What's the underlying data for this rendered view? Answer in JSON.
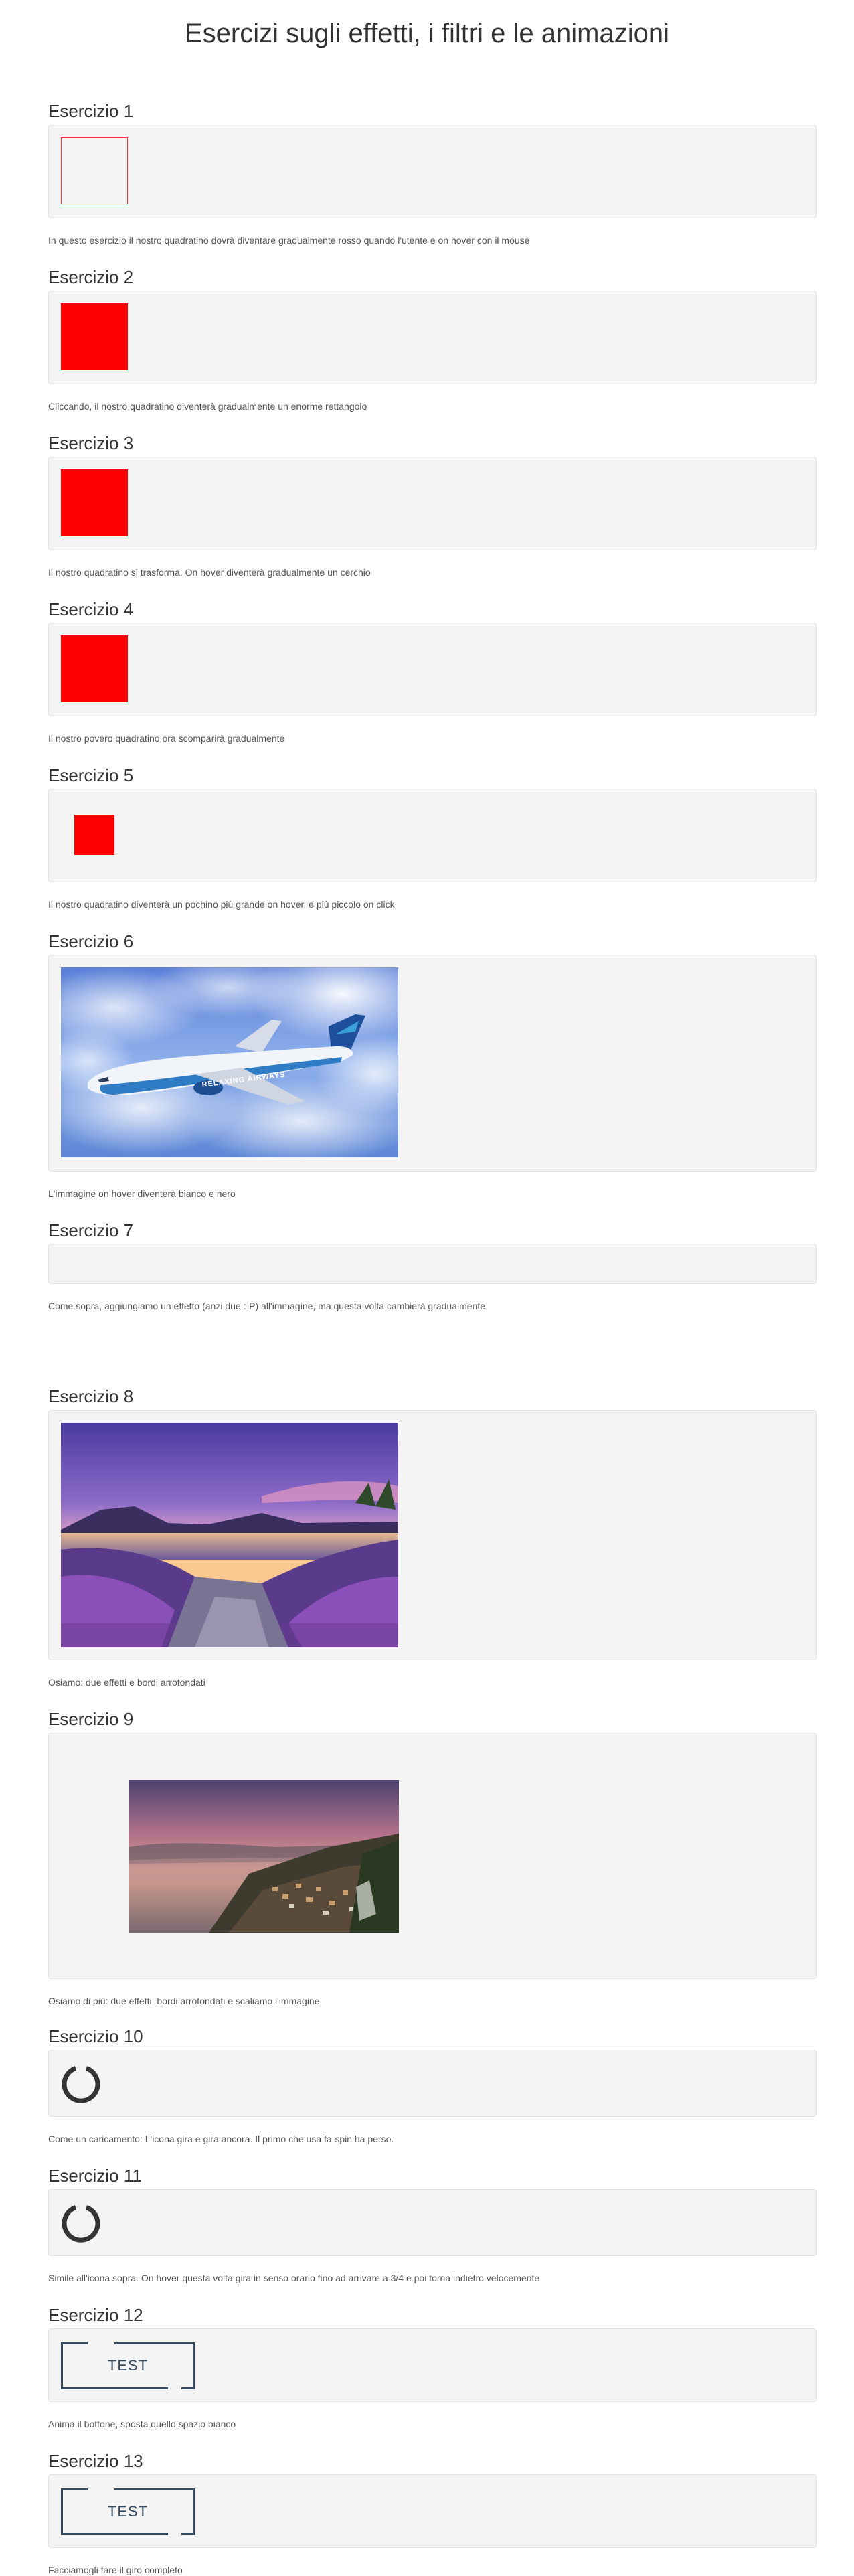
{
  "page": {
    "title": "Esercizi sugli effetti, i filtri e le animazioni"
  },
  "exercises": [
    {
      "title": "Esercizio 1",
      "description": "In questo esercizio il nostro quadratino dovrà diventare gradualmente rosso quando l'utente e on hover con il mouse"
    },
    {
      "title": "Esercizio 2",
      "description": "Cliccando, il nostro quadratino diventerà gradualmente un enorme rettangolo"
    },
    {
      "title": "Esercizio 3",
      "description": "Il nostro quadratino si trasforma. On hover diventerà gradualmente un cerchio"
    },
    {
      "title": "Esercizio 4",
      "description": "Il nostro povero quadratino ora scomparirà gradualmente"
    },
    {
      "title": "Esercizio 5",
      "description": "Il nostro quadratino diventerà un pochino più grande on hover, e più piccolo on click"
    },
    {
      "title": "Esercizio 6",
      "description": "L'immagine on hover diventerà bianco e nero",
      "image_text": "RELAXING AIRWAYS"
    },
    {
      "title": "Esercizio 7",
      "description": "Come sopra, aggiungiamo un effetto (anzi due :-P) all'immagine, ma questa volta cambierà gradualmente"
    },
    {
      "title": "Esercizio 8",
      "description": "Osiamo: due effetti e bordi arrotondati"
    },
    {
      "title": "Esercizio 9",
      "description": "Osiamo di più: due effetti, bordi arrotondati e scaliamo l'immagine"
    },
    {
      "title": "Esercizio 10",
      "description": "Come un caricamento: L'icona gira e gira ancora. Il primo che usa fa-spin ha perso."
    },
    {
      "title": "Esercizio 11",
      "description": "Simile all'icona sopra. On hover questa volta gira in senso orario fino ad arrivare a 3/4 e poi torna indietro velocemente"
    },
    {
      "title": "Esercizio 12",
      "description": "Anima il bottone, sposta quello spazio bianco",
      "button_label": "TEST"
    },
    {
      "title": "Esercizio 13",
      "description": "Facciamogli fare il giro completo",
      "button_label": "TEST"
    }
  ],
  "colors": {
    "square_red": "#ff0000",
    "box_background": "#f4f4f4",
    "button_frame": "#34495e"
  }
}
